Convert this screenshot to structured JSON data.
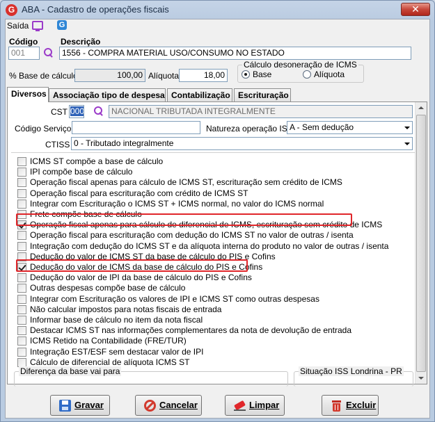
{
  "window": {
    "title": "ABA - Cadastro de operações fiscais",
    "logo_letter": "G"
  },
  "menu": {
    "exit_label": "Saída"
  },
  "header": {
    "code_label": "Código",
    "code_value": "001",
    "description_label": "Descrição",
    "description_value": "1556 - COMPRA MATERIAL USO/CONSUMO NO ESTADO",
    "base_label": "% Base de cálculo",
    "base_value": "100,00",
    "rate_label": "Alíquota",
    "rate_value": "18,00",
    "desoneracao": {
      "title": "Cálculo desoneração de ICMS",
      "options": [
        {
          "label": "Base",
          "selected": true
        },
        {
          "label": "Alíquota",
          "selected": false
        }
      ]
    }
  },
  "tabs": [
    {
      "label": "Diversos",
      "active": true
    },
    {
      "label": "Associação tipo de despesa",
      "active": false
    },
    {
      "label": "Contabilização",
      "active": false
    },
    {
      "label": "Escrituração",
      "active": false
    }
  ],
  "diversos": {
    "cst_label": "CST",
    "cst_code": "000",
    "cst_desc": "NACIONAL TRIBUTADA INTEGRALMENTE",
    "service_code_label": "Código Serviço",
    "service_code_value": "",
    "iss_nature_label": "Natureza operação ISS",
    "iss_nature_value": "A - Sem dedução",
    "ctiss_label": "CTISS",
    "ctiss_value": "0 - Tributado integralmente",
    "checkboxes": [
      {
        "label": "ICMS ST compõe a base de cálculo",
        "checked": false
      },
      {
        "label": "IPI compõe base de cálculo",
        "checked": false
      },
      {
        "label": "Operação fiscal apenas para cálculo de ICMS ST, escrituração sem crédito de ICMS",
        "checked": false
      },
      {
        "label": "Operação fiscal para escrituração com crédito de ICMS ST",
        "checked": false
      },
      {
        "label": "Integrar com Escrituração o ICMS ST + ICMS normal,  no valor do ICMS normal",
        "checked": false
      },
      {
        "label": "Frete compõe base de cálculo",
        "checked": false
      },
      {
        "label": "Operação fiscal apenas para cálculo de diferencial de ICMS, escrituração sem crédito de ICMS",
        "checked": true
      },
      {
        "label": "Operação fiscal para escrituração com dedução do ICMS ST no valor de outras / isenta",
        "checked": false
      },
      {
        "label": "Integração com dedução do ICMS ST e da alíquota interna do produto no valor de outras / isenta",
        "checked": false
      },
      {
        "label": "Dedução do valor de ICMS ST da base de cálculo do PIS e Cofins",
        "checked": false
      },
      {
        "label": "Dedução do valor de ICMS da base de cálculo do PIS e Cofins",
        "checked": true
      },
      {
        "label": "Dedução do valor de IPI da base de cálculo do PIS e Cofins",
        "checked": false
      },
      {
        "label": "Outras despesas compõe base de cálculo",
        "checked": false
      },
      {
        "label": "Integrar com Escrituração os valores de IPI e ICMS ST como outras despesas",
        "checked": false
      },
      {
        "label": "Não calcular impostos para notas fiscais de entrada",
        "checked": false
      },
      {
        "label": "Informar base de cálculo no item da nota fiscal",
        "checked": false
      },
      {
        "label": "Destacar ICMS ST nas informações complementares da nota de devolução de entrada",
        "checked": false
      },
      {
        "label": "ICMS Retido na Contabilidade (FRE/TUR)",
        "checked": false
      },
      {
        "label": "Integração EST/ESF sem destacar valor de IPI",
        "checked": false
      },
      {
        "label": "Cálculo de diferencial de alíquota ICMS ST",
        "checked": false
      }
    ],
    "group_base_diff": "Diferença da base vai para",
    "group_iss_londrina": "Situação ISS Londrina - PR"
  },
  "buttons": {
    "save": "Gravar",
    "cancel": "Cancelar",
    "clear": "Limpar",
    "delete": "Excluir"
  },
  "colors": {
    "highlight": "#e0262a",
    "accent_purple": "#9b3bc9",
    "close_red": "#c7473a"
  }
}
